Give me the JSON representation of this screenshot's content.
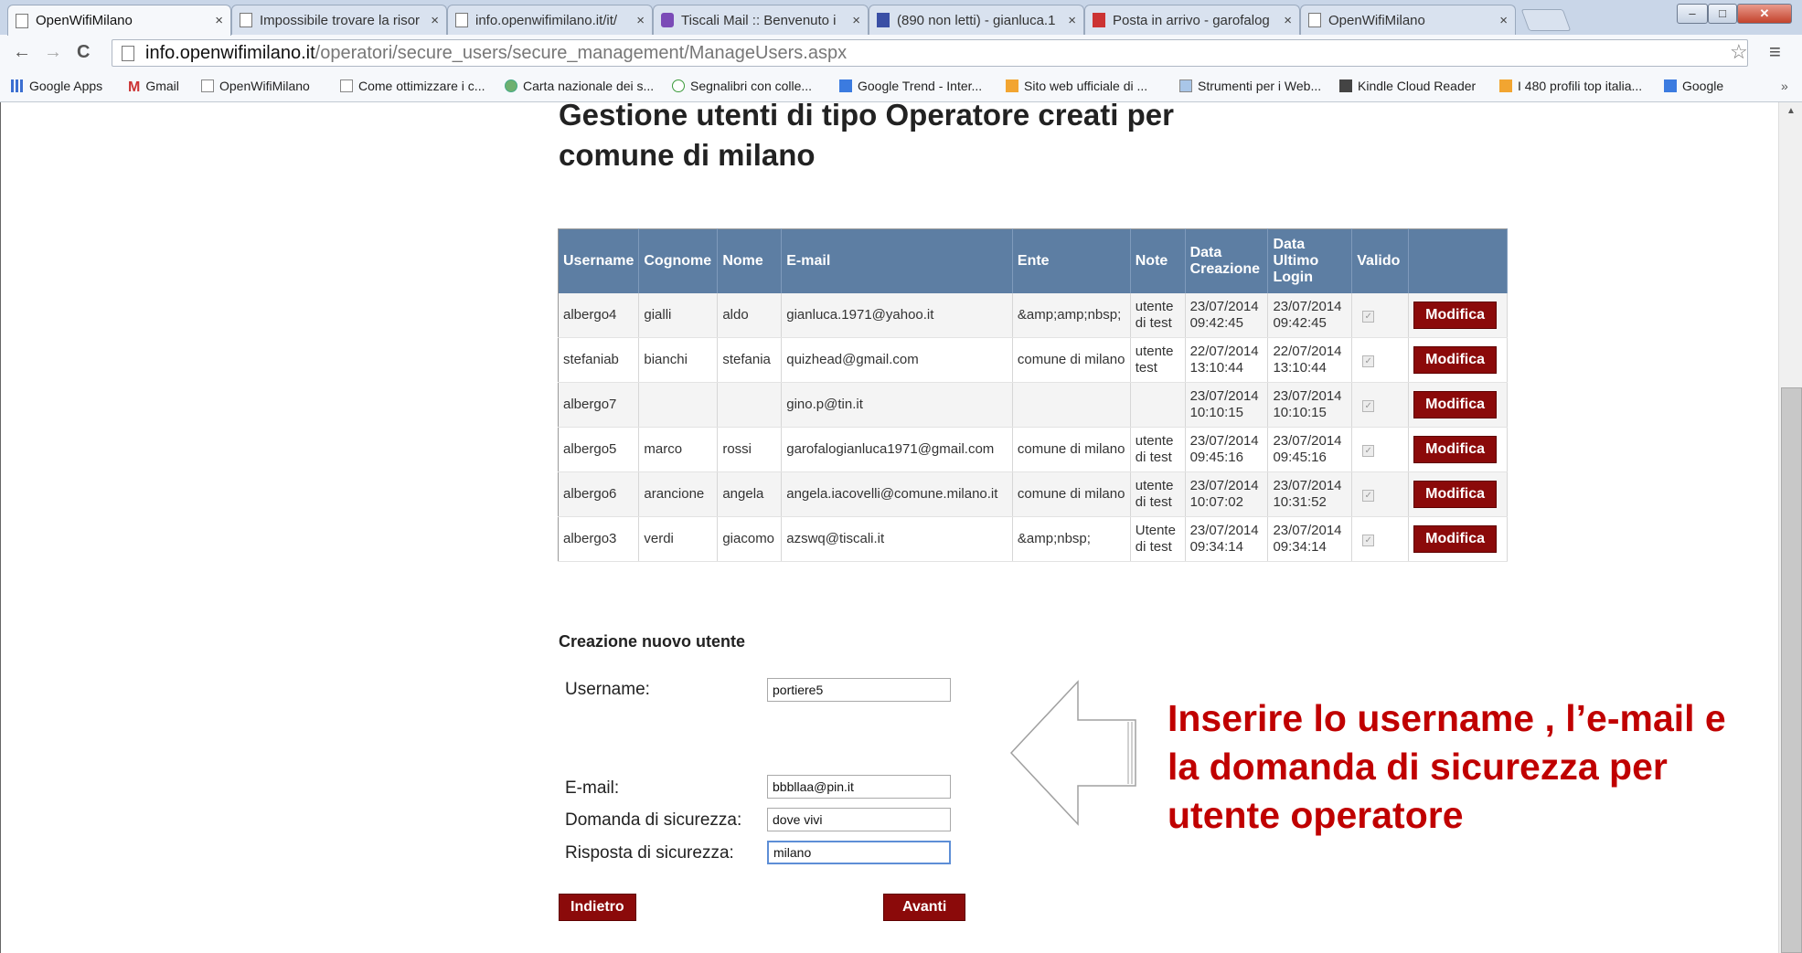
{
  "browser": {
    "tabs": [
      {
        "label": "OpenWifiMilano",
        "icon": "page-icon",
        "active": true
      },
      {
        "label": "Impossibile trovare la risor",
        "icon": "page-icon"
      },
      {
        "label": "info.openwifimilano.it/it/",
        "icon": "page-icon"
      },
      {
        "label": "Tiscali Mail :: Benvenuto i",
        "icon": "tiscali-icon"
      },
      {
        "label": "(890 non letti) - gianluca.1",
        "icon": "envelope-icon"
      },
      {
        "label": "Posta in arrivo - garofalog",
        "icon": "gmail-icon"
      },
      {
        "label": "OpenWifiMilano",
        "icon": "page-icon"
      }
    ],
    "close_glyph": "×",
    "url_host": "info.openwifimilano.it",
    "url_path": "/operatori/secure_users/secure_management/ManageUsers.aspx",
    "bookmarks": [
      {
        "label": "Google Apps",
        "icon": "apps-grid-icon"
      },
      {
        "label": "Gmail",
        "icon": "gmail-icon"
      },
      {
        "label": "OpenWifiMilano",
        "icon": "page-icon"
      },
      {
        "label": "Come ottimizzare i c...",
        "icon": "page-icon"
      },
      {
        "label": "Carta nazionale dei s...",
        "icon": "globe-icon"
      },
      {
        "label": "Segnalibri con colle...",
        "icon": "circle-icon"
      },
      {
        "label": "Google Trend - Inter...",
        "icon": "google-icon"
      },
      {
        "label": "Sito web ufficiale di ...",
        "icon": "site-icon"
      },
      {
        "label": "Strumenti per i Web...",
        "icon": "tools-icon"
      },
      {
        "label": "Kindle Cloud Reader",
        "icon": "kindle-icon"
      },
      {
        "label": "I 480 profili top italia...",
        "icon": "profile-icon"
      },
      {
        "label": "Google",
        "icon": "google-icon"
      }
    ],
    "bookmarks_more": "»"
  },
  "page": {
    "title": "Gestione utenti di tipo Operatore creati per comune di milano",
    "table": {
      "headers": [
        "Username",
        "Cognome",
        "Nome",
        "E-mail",
        "Ente",
        "Note",
        "Data Creazione",
        "Data Ultimo Login",
        "Valido",
        ""
      ],
      "rows": [
        {
          "username": "albergo4",
          "cognome": "gialli",
          "nome": "aldo",
          "email": "gianluca.1971@yahoo.it",
          "ente": "&amp;amp;nbsp;",
          "note": "utente di test",
          "creazione": "23/07/2014 09:42:45",
          "login": "23/07/2014 09:42:45",
          "valido": true,
          "action": "Modifica"
        },
        {
          "username": "stefaniab",
          "cognome": "bianchi",
          "nome": "stefania",
          "email": "quizhead@gmail.com",
          "ente": "comune di milano",
          "note": "utente test",
          "creazione": "22/07/2014 13:10:44",
          "login": "22/07/2014 13:10:44",
          "valido": true,
          "action": "Modifica"
        },
        {
          "username": "albergo7",
          "cognome": "",
          "nome": "",
          "email": "gino.p@tin.it",
          "ente": "",
          "note": "",
          "creazione": "23/07/2014 10:10:15",
          "login": "23/07/2014 10:10:15",
          "valido": true,
          "action": "Modifica"
        },
        {
          "username": "albergo5",
          "cognome": "marco",
          "nome": "rossi",
          "email": "garofalogianluca1971@gmail.com",
          "ente": "comune di milano",
          "note": "utente di test",
          "creazione": "23/07/2014 09:45:16",
          "login": "23/07/2014 09:45:16",
          "valido": true,
          "action": "Modifica"
        },
        {
          "username": "albergo6",
          "cognome": "arancione",
          "nome": "angela",
          "email": "angela.iacovelli@comune.milano.it",
          "ente": "comune di milano",
          "note": "utente di test",
          "creazione": "23/07/2014 10:07:02",
          "login": "23/07/2014 10:31:52",
          "valido": true,
          "action": "Modifica"
        },
        {
          "username": "albergo3",
          "cognome": "verdi",
          "nome": "giacomo",
          "email": "azswq@tiscali.it",
          "ente": "&amp;nbsp;",
          "note": "Utente di test",
          "creazione": "23/07/2014 09:34:14",
          "login": "23/07/2014 09:34:14",
          "valido": true,
          "action": "Modifica"
        }
      ]
    },
    "form": {
      "heading": "Creazione nuovo utente",
      "username_label": "Username:",
      "username_value": "portiere5",
      "email_label": "E-mail:",
      "email_value": "bbbllaa@pin.it",
      "question_label": "Domanda di sicurezza:",
      "question_value": "dove vivi",
      "answer_label": "Risposta di sicurezza:",
      "answer_value": "milano",
      "back_label": "Indietro",
      "next_label": "Avanti"
    },
    "callout": "Inserire lo username , l’e-mail e la domanda di sicurezza per utente operatore"
  },
  "colors": {
    "header_bg": "#5d7ea3",
    "button_bg": "#8b0a0a",
    "callout_text": "#c00000"
  }
}
